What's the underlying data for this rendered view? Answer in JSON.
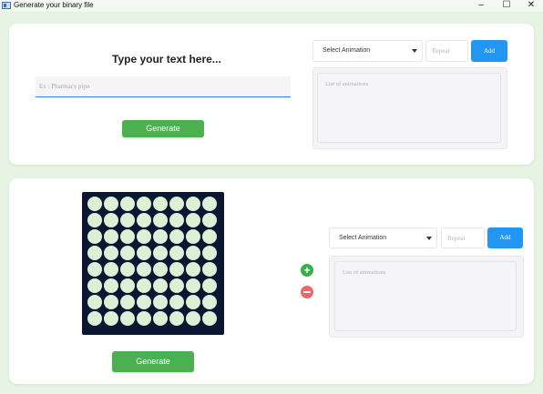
{
  "window": {
    "title": "Generate your binary file",
    "controls": {
      "minimize": "–",
      "maximize": "☐",
      "close": "✕"
    }
  },
  "text_section": {
    "heading": "Type your text here...",
    "input_placeholder": "Ex : Pharmacy pipo",
    "generate_label": "Generate",
    "animation_select": "Select Animation",
    "repeat_placeholder": "Repeat",
    "add_label": "Add",
    "animations_placeholder": "List of animations"
  },
  "matrix_section": {
    "rows": 8,
    "cols": 8,
    "generate_label": "Generate",
    "add_frame_label": "+",
    "animation_select": "Select Animation",
    "repeat_placeholder": "Repeat",
    "add_label": "Add",
    "animations_placeholder": "List of animations"
  },
  "colors": {
    "background": "#e7f3e3",
    "generate_button": "#4caf50",
    "add_button": "#2196f3",
    "matrix_background": "#0b1633",
    "led_off": "#dbf0d4",
    "plus_button": "#34b14b",
    "minus_button": "#f06565"
  },
  "icons": {
    "app": "window-app-icon",
    "dropdown": "chevron-down-icon",
    "plus": "plus-circle-icon",
    "minus": "minus-circle-icon"
  }
}
